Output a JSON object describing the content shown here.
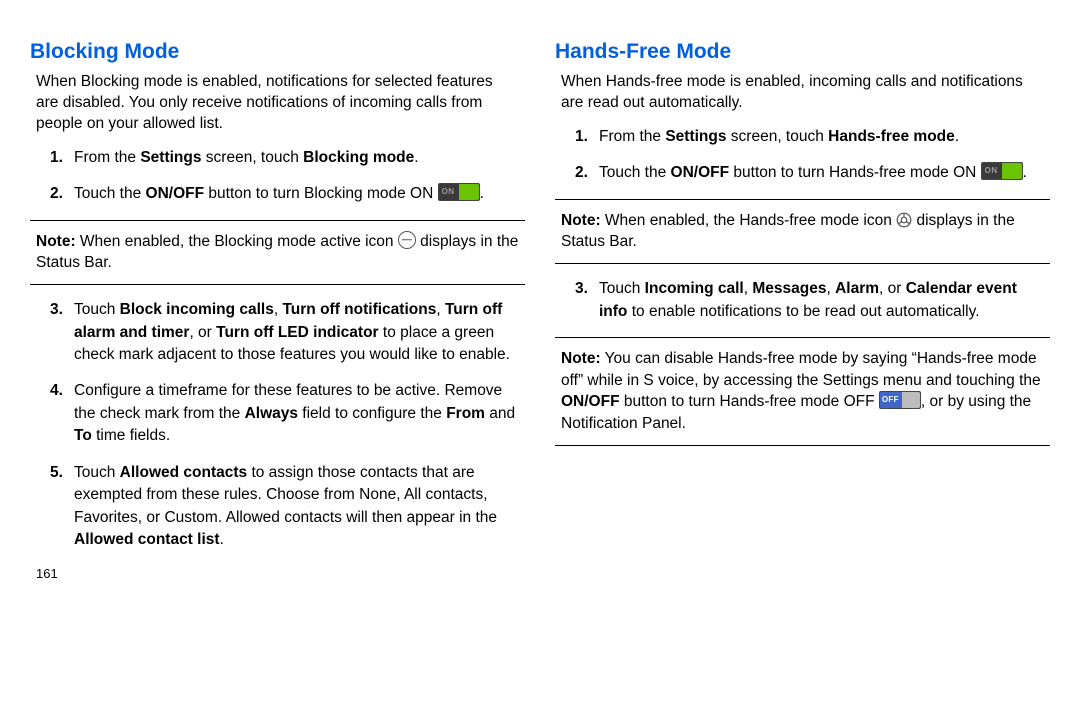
{
  "page_number": "161",
  "left": {
    "heading": "Blocking Mode",
    "intro": "When Blocking mode is enabled, notifications for selected features are disabled. You only receive notifications of incoming calls from people on your allowed list.",
    "steps": {
      "s1_a": "From the ",
      "s1_b": "Settings",
      "s1_c": " screen, touch ",
      "s1_d": "Blocking mode",
      "s1_e": ".",
      "s2_a": "Touch the ",
      "s2_b": "ON/OFF",
      "s2_c": " button to turn Blocking mode ON ",
      "s2_d": ".",
      "s3_a": "Touch ",
      "s3_b": "Block incoming calls",
      "s3_c": ", ",
      "s3_d": "Turn off notifications",
      "s3_e": ", ",
      "s3_f": "Turn off alarm and timer",
      "s3_g": ", or ",
      "s3_h": "Turn off LED indicator",
      "s3_i": " to place a green check mark adjacent to those features you would like to enable.",
      "s4_a": "Configure a timeframe for these features to be active. Remove the check mark from the ",
      "s4_b": "Always",
      "s4_c": " field to configure the ",
      "s4_d": "From",
      "s4_e": " and ",
      "s4_f": "To",
      "s4_g": " time fields.",
      "s5_a": "Touch ",
      "s5_b": "Allowed contacts",
      "s5_c": " to assign those contacts that are exempted from these rules. Choose from None, All contacts, Favorites, or Custom. Allowed contacts will then appear in the ",
      "s5_d": "Allowed contact list",
      "s5_e": "."
    },
    "note": {
      "label": "Note:",
      "a": " When enabled, the Blocking mode active icon ",
      "b": " displays in the Status Bar."
    }
  },
  "right": {
    "heading": "Hands-Free Mode",
    "intro": "When Hands-free mode is enabled, incoming calls and notifications are read out automatically.",
    "steps": {
      "s1_a": "From the ",
      "s1_b": "Settings",
      "s1_c": " screen, touch ",
      "s1_d": "Hands-free mode",
      "s1_e": ".",
      "s2_a": "Touch the ",
      "s2_b": "ON/OFF",
      "s2_c": " button to turn Hands-free mode ON ",
      "s2_d": ".",
      "s3_a": "Touch ",
      "s3_b": "Incoming call",
      "s3_c": ", ",
      "s3_d": "Messages",
      "s3_e": ", ",
      "s3_f": "Alarm",
      "s3_g": ", or ",
      "s3_h": "Calendar event info",
      "s3_i": " to enable notifications to be read out automatically."
    },
    "note1": {
      "label": "Note:",
      "a": " When enabled, the Hands-free mode icon ",
      "b": " displays in the Status Bar."
    },
    "note2": {
      "label": "Note:",
      "a": " You can disable Hands-free mode by saying “Hands-free mode off” while in S voice, by accessing the Settings menu and touching the ",
      "b": "ON/OFF",
      "c": " button to turn Hands-free mode OFF ",
      "d": ", or by using the Notification Panel."
    }
  }
}
